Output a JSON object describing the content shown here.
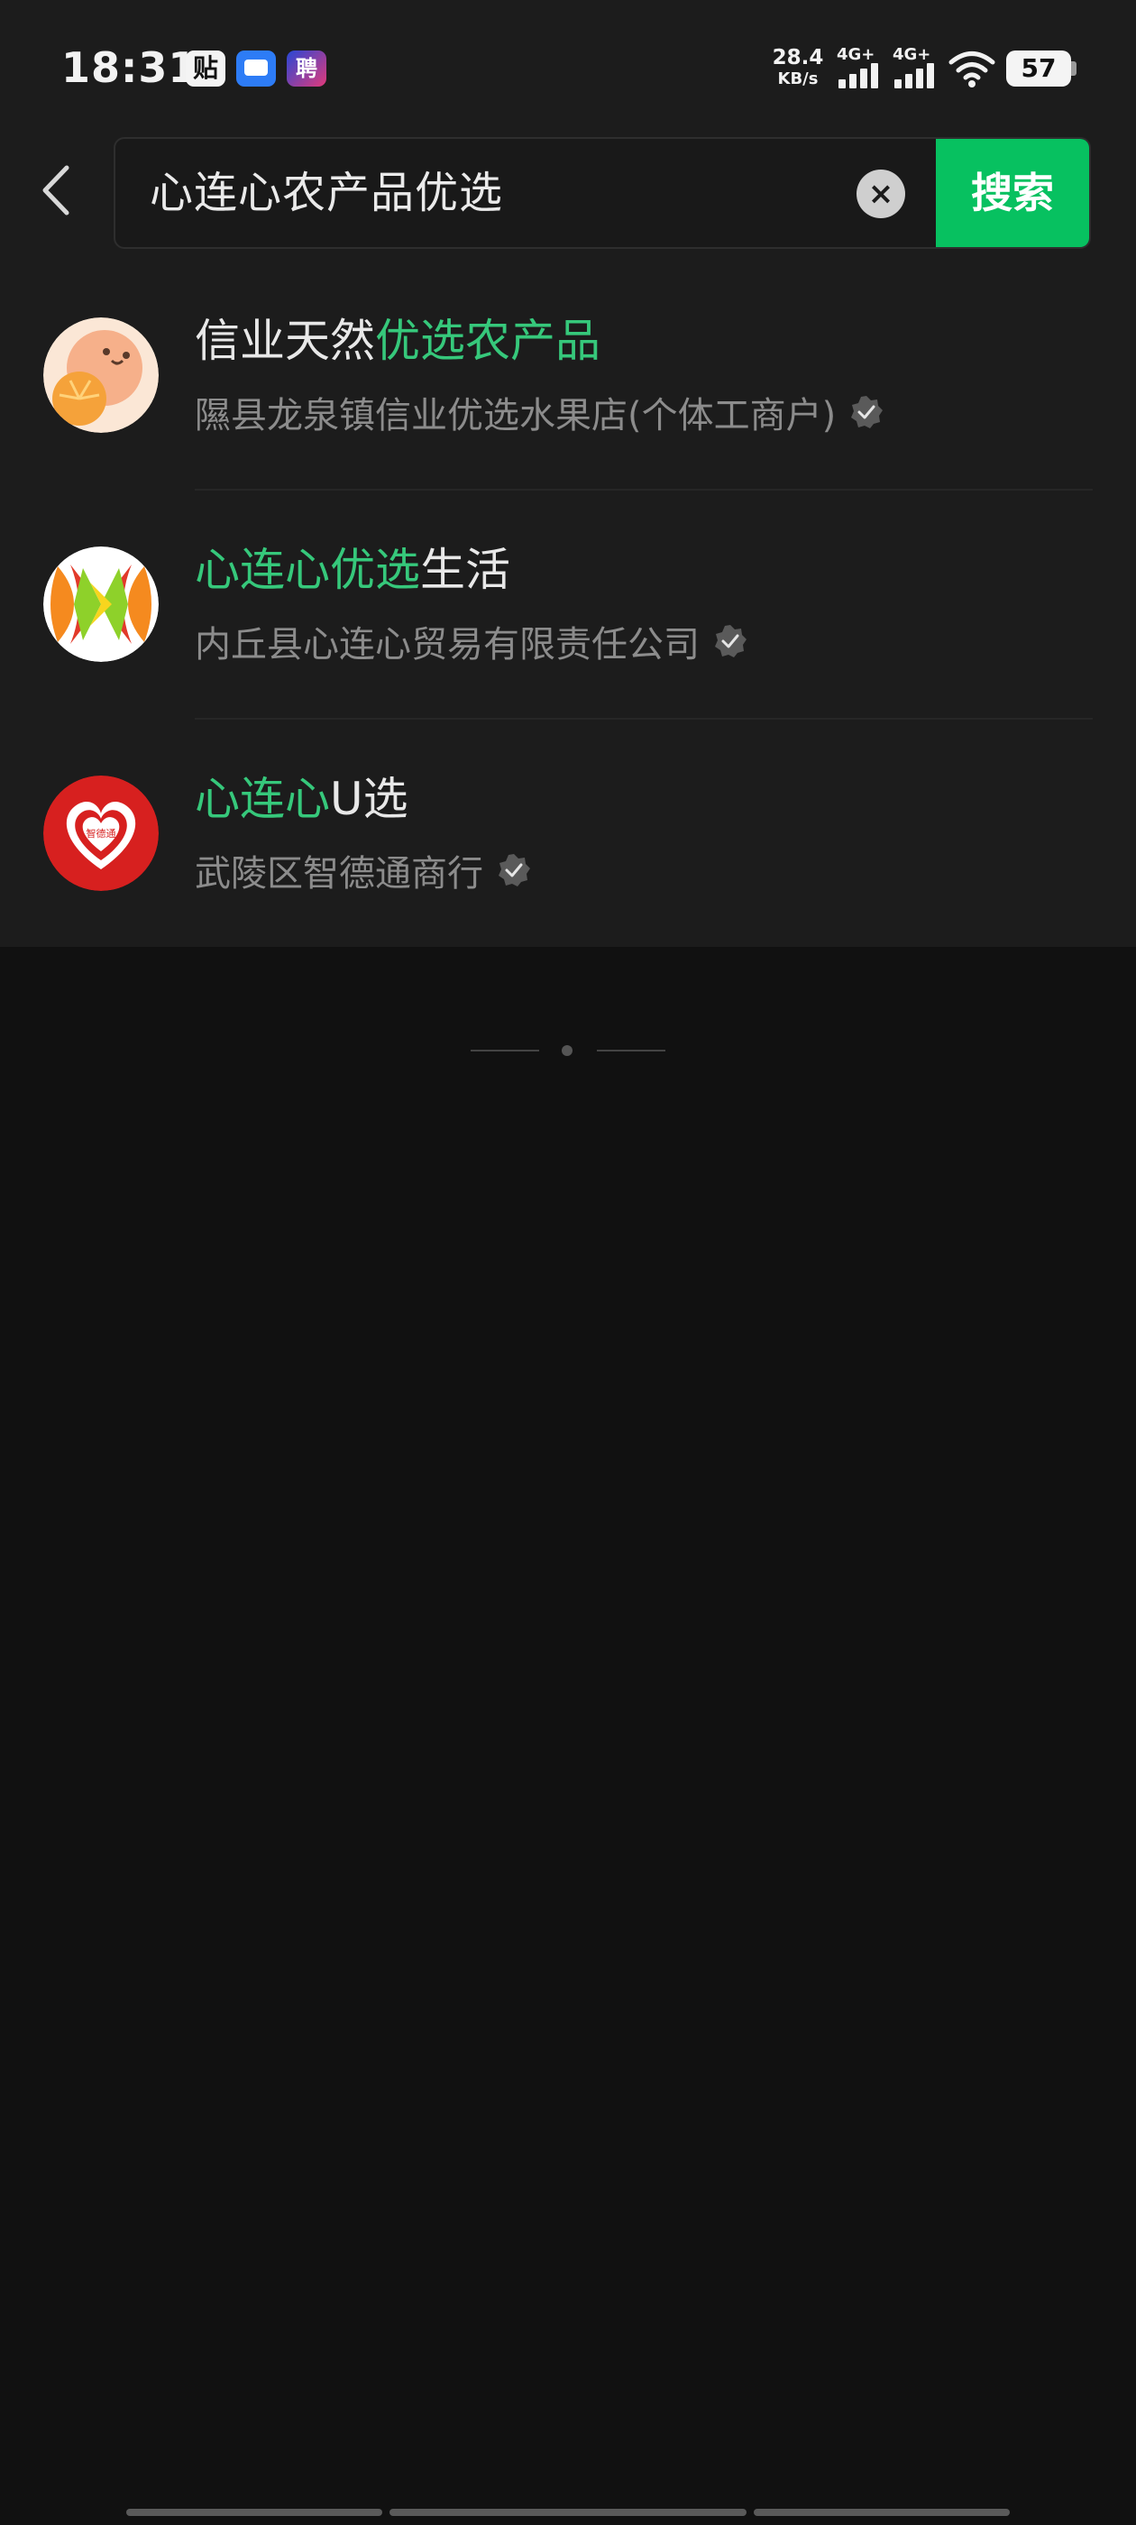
{
  "status_bar": {
    "time": "18:31",
    "notif_tie_label": "贴",
    "notif_job_label": "聘",
    "net_speed_value": "28.4",
    "net_speed_unit": "KB/s",
    "signal1_label": "4G+",
    "signal2_label": "4G+",
    "battery_level": "57"
  },
  "search": {
    "query": "心连心农产品优选",
    "clear_icon": "close-icon",
    "button_label": "搜索"
  },
  "results": [
    {
      "title_parts": [
        {
          "text": "信业天然",
          "highlight": false
        },
        {
          "text": "优选农产品",
          "highlight": true
        }
      ],
      "subtitle": "隰县龙泉镇信业优选水果店(个体工商户)",
      "verified": true
    },
    {
      "title_parts": [
        {
          "text": "心连心优选",
          "highlight": true
        },
        {
          "text": "生活",
          "highlight": false
        }
      ],
      "subtitle": "内丘县心连心贸易有限责任公司",
      "verified": true
    },
    {
      "title_parts": [
        {
          "text": "心连心",
          "highlight": true
        },
        {
          "text": "U选",
          "highlight": false
        }
      ],
      "subtitle": "武陵区智德通商行",
      "avatar_text": "智德通",
      "verified": true
    }
  ],
  "colors": {
    "accent_green": "#07c160",
    "highlight_green": "#36c87b",
    "background": "#111111",
    "panel": "#1c1c1c"
  }
}
